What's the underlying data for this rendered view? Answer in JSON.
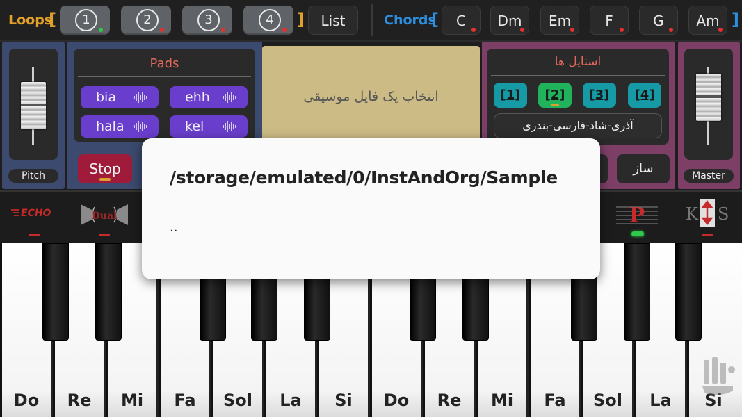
{
  "topbar": {
    "loops_label": "Loops",
    "loops_open": "[",
    "loops_close": "]",
    "loops": [
      {
        "label": "1",
        "status": "green"
      },
      {
        "label": "2",
        "status": "red"
      },
      {
        "label": "3",
        "status": "red"
      },
      {
        "label": "4",
        "status": "red"
      }
    ],
    "list_label": "List",
    "chords_label": "Chords",
    "chords_open": "[",
    "chords_close": "]",
    "chords": [
      "C",
      "Dm",
      "Em",
      "F",
      "G",
      "Am"
    ]
  },
  "pitch": {
    "label": "Pitch"
  },
  "master": {
    "label": "Master"
  },
  "pads": {
    "title": "Pads",
    "items": [
      "bia",
      "ehh",
      "hala",
      "kel"
    ]
  },
  "stop_label": "Stop",
  "file": {
    "text": "انتخاب یک فایل موسیقی"
  },
  "styles": {
    "title": "استایل ها",
    "buttons": [
      "[1]",
      "[2]",
      "[3]",
      "[4]"
    ],
    "selected": 1,
    "name": "آذری-شاد-فارسی-بندری"
  },
  "saz_label": "ساز",
  "fx": {
    "echo_label": "ECHO",
    "dual_label": "Dual",
    "p_label": "P",
    "ks_k": "K",
    "ks_s": "S"
  },
  "piano": {
    "keys": [
      "Do",
      "Re",
      "Mi",
      "Fa",
      "Sol",
      "La",
      "Si",
      "Do",
      "Re",
      "Mi",
      "Fa",
      "Sol",
      "La",
      "Si"
    ]
  },
  "dialog": {
    "path": "/storage/emulated/0/InstAndOrg/Sample",
    "up": ".."
  },
  "colors": {
    "loops_accent": "#e0a02a",
    "chords_accent": "#2d8fe0",
    "pads_title": "#e36a5a",
    "styles_title": "#e36a5a",
    "fx_red": "#c62a2a"
  }
}
